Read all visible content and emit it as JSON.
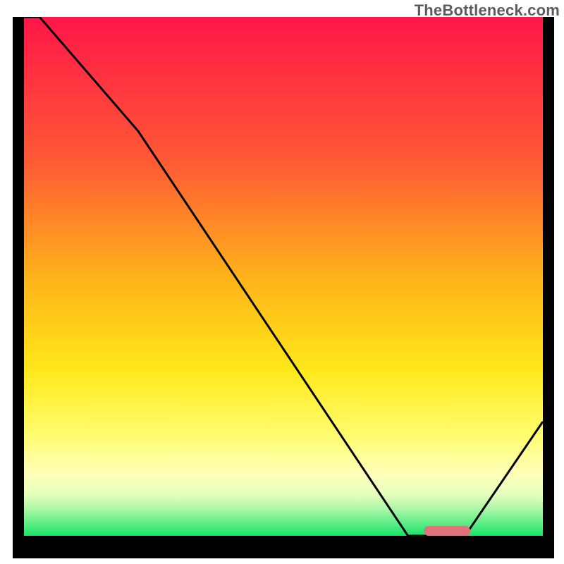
{
  "watermark": "TheBottleneck.com",
  "chart_data": {
    "type": "line",
    "title": "",
    "xlabel": "",
    "ylabel": "",
    "xlim": [
      0,
      100
    ],
    "ylim": [
      0,
      100
    ],
    "x": [
      0,
      3,
      22,
      74,
      80,
      85,
      100
    ],
    "values": [
      100,
      100,
      78,
      0,
      0,
      0,
      22
    ],
    "optimal_range": {
      "x_start": 77,
      "x_end": 86,
      "y": 0
    },
    "gradient_stops": [
      {
        "offset": 0,
        "color": "#ff1648"
      },
      {
        "offset": 28,
        "color": "#ff5a35"
      },
      {
        "offset": 50,
        "color": "#ffb21a"
      },
      {
        "offset": 68,
        "color": "#ffe81a"
      },
      {
        "offset": 80,
        "color": "#fffc6a"
      },
      {
        "offset": 88,
        "color": "#ffffb8"
      },
      {
        "offset": 92,
        "color": "#e6ffbe"
      },
      {
        "offset": 95,
        "color": "#a6f7a6"
      },
      {
        "offset": 100,
        "color": "#18e46a"
      }
    ],
    "optimal_bar_color": "#e0727a",
    "curve_color": "#000000"
  }
}
